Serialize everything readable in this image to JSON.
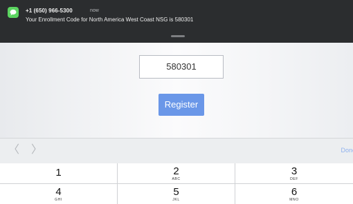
{
  "notification": {
    "sender": "+1 (650) 966-5300",
    "time": "now",
    "message": "Your Enrollment Code for North America West Coast NSG is 580301",
    "app_icon": "messages-icon",
    "app_icon_color": "#5bd460"
  },
  "form": {
    "code_value": "580301",
    "register_label": "Register",
    "accent_color": "#6a97e8"
  },
  "accessory_bar": {
    "prev_icon": "chevron-left-icon",
    "next_icon": "chevron-right-icon",
    "prev_glyph": "〈",
    "next_glyph": "〉",
    "done_label": "Done"
  },
  "keypad": {
    "keys": [
      {
        "digit": "1",
        "letters": ""
      },
      {
        "digit": "2",
        "letters": "ABC"
      },
      {
        "digit": "3",
        "letters": "DEF"
      },
      {
        "digit": "4",
        "letters": "GHI"
      },
      {
        "digit": "5",
        "letters": "JKL"
      },
      {
        "digit": "6",
        "letters": "MNO"
      }
    ]
  }
}
